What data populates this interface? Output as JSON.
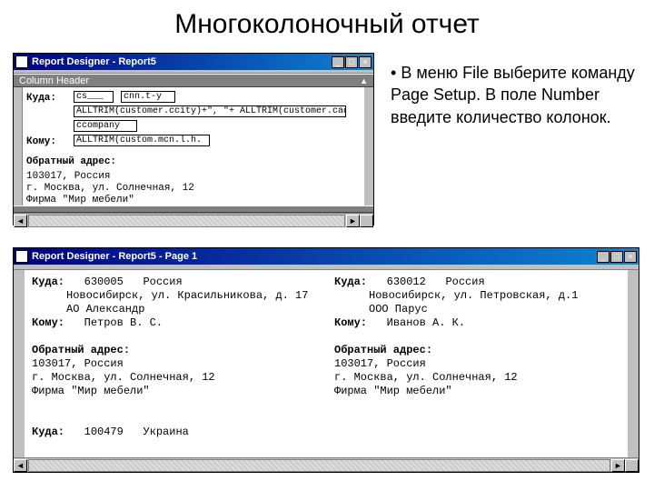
{
  "slide": {
    "title": "Многоколоночный отчет",
    "bullet": "В меню File выберите команду Page Setup. В поле Number введите количество колонок."
  },
  "win1": {
    "title": "Report Designer - Report5",
    "titlebar_buttons": {
      "min": "_",
      "max": "□",
      "close": "×"
    },
    "band_label": "Column Header",
    "labels": {
      "kuda": "Куда:",
      "komu": "Кому:",
      "retaddr": "Обратный адрес:"
    },
    "fields": {
      "box1": "cs___",
      "box2": "cnn.t-y",
      "expr1": "ALLTRIM(customer.ccity)+\", \"+ ALLTRIM(customer.caddres",
      "expr2": "ccompany",
      "expr3": "ALLTRIM(custom.mcn.l.h.",
      "ret1": "103017, Россия",
      "ret2": "г. Москва, ул. Солнечная, 12",
      "ret3": "Фирма \"Мир мебели\""
    }
  },
  "win2": {
    "title": "Report Designer - Report5 - Page 1",
    "titlebar_buttons": {
      "min": "_",
      "max": "□",
      "close": "×"
    },
    "left": {
      "kuda_label": "Куда:",
      "kuda_code": "630005",
      "kuda_country": "Россия",
      "addr": "Новосибирск, ул. Красильникова, д. 17",
      "company": "АО Александр",
      "komu_label": "Кому:",
      "komu": "Петров В. С.",
      "ret_label": "Обратный адрес:",
      "ret1": "103017, Россия",
      "ret2": "г. Москва, ул. Солнечная, 12",
      "ret3": "Фирма \"Мир мебели\"",
      "kuda2_label": "Куда:",
      "kuda2_code": "100479",
      "kuda2_country": "Украина"
    },
    "right": {
      "kuda_label": "Куда:",
      "kuda_code": "630012",
      "kuda_country": "Россия",
      "addr": "Новосибирск, ул. Петровская, д.1",
      "company": "ООО Парус",
      "komu_label": "Кому:",
      "komu": "Иванов А. К.",
      "ret_label": "Обратный адрес:",
      "ret1": "103017, Россия",
      "ret2": "г. Москва, ул. Солнечная, 12",
      "ret3": "Фирма \"Мир мебели\""
    }
  }
}
